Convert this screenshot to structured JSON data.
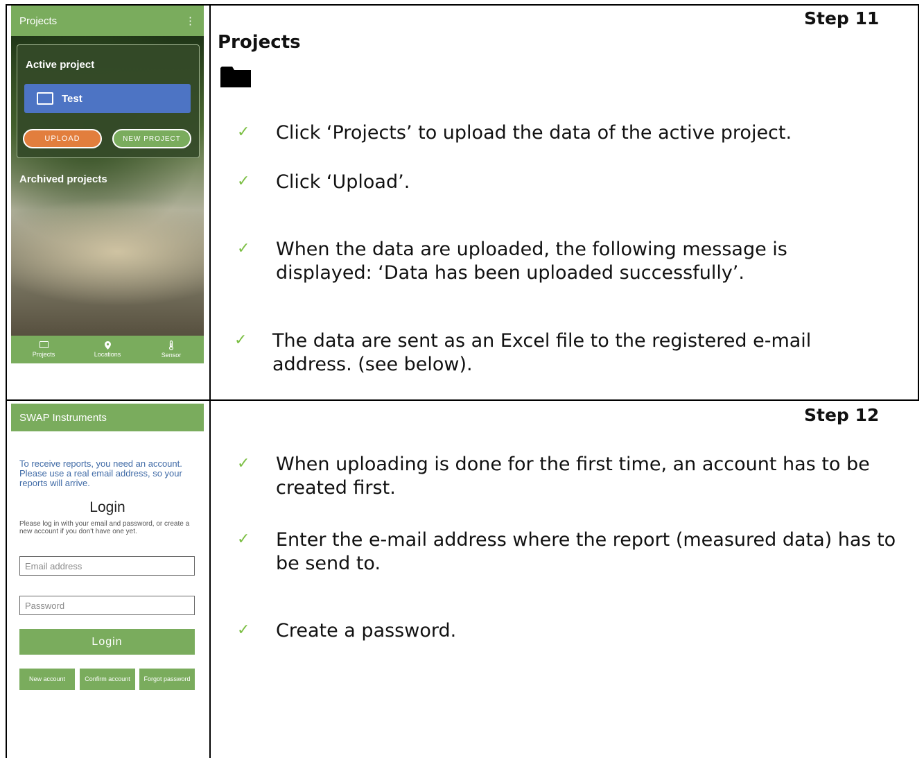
{
  "step11": {
    "step_label": "Step 11",
    "heading": "Projects",
    "bullets": [
      "Click ‘Projects’ to upload the data of the active project.",
      "Click ‘Upload’.",
      "When the data are uploaded, the following message is displayed: ‘Data has been uploaded successfully’.",
      "The data are sent as an Excel file to the registered e-mail address. (see below)."
    ],
    "phone": {
      "title": "Projects",
      "menu_glyph": "⋮",
      "active_title": "Active project",
      "project_name": "Test",
      "upload_label": "UPLOAD",
      "new_project_label": "NEW PROJECT",
      "archived_title": "Archived projects",
      "nav": [
        {
          "label": "Projects",
          "icon": "folder-icon"
        },
        {
          "label": "Locations",
          "icon": "location-pin-icon"
        },
        {
          "label": "Sensor",
          "icon": "thermometer-icon"
        }
      ]
    }
  },
  "step12": {
    "step_label": "Step 12",
    "bullets": [
      "When uploading is done for the first time, an account has to be created first.",
      "Enter the e-mail address where the report (measured data) has to be send to.",
      "Create a password."
    ],
    "phone": {
      "title": "SWAP Instruments",
      "info": "To receive reports, you need an account. Please use a real email address, so your reports will arrive.",
      "login_title": "Login",
      "login_sub": "Please log in with your email and password, or create a new account if you don't have one yet.",
      "email_placeholder": "Email address",
      "password_placeholder": "Password",
      "login_button": "Login",
      "new_account": "New account",
      "confirm_account": "Confirm account",
      "forgot_password": "Forgot password"
    }
  },
  "check_glyph": "✓",
  "colors": {
    "green": "#7aac5d",
    "check_green": "#7cbf44",
    "upload_orange": "#e27e3d",
    "project_blue": "#4d74c4",
    "info_blue": "#3f6aa6"
  }
}
